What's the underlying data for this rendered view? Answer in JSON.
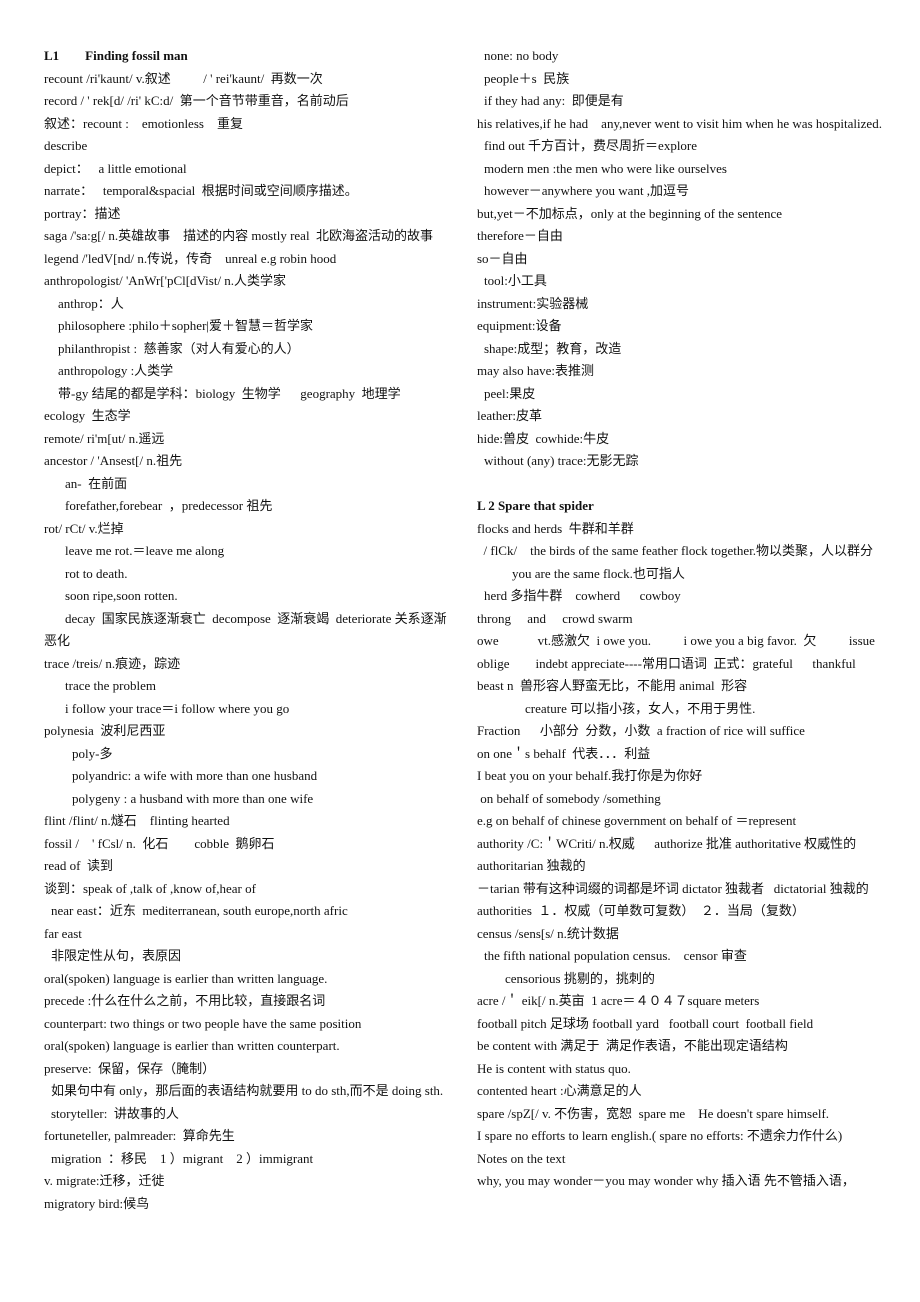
{
  "left_column": [
    {
      "text": "L1        Finding fossil man",
      "style": "bold",
      "indent": 0
    },
    {
      "text": "recount /ri'kaunt/ v.叙述          / ' rei'kaunt/  再数一次",
      "indent": 0
    },
    {
      "text": "record / ' rek[d/ /ri' kC:d/  第一个音节带重音，名前动后",
      "indent": 0
    },
    {
      "text": "叙述：recount :    emotionless    重复",
      "indent": 0
    },
    {
      "text": "describe",
      "indent": 0
    },
    {
      "text": "depict：   a little emotional",
      "indent": 0
    },
    {
      "text": "narrate：   temporal&spacial  根据时间或空间顺序描述。",
      "indent": 0
    },
    {
      "text": "portray：描述",
      "indent": 0
    },
    {
      "text": "saga /'sa:g[/ n.英雄故事    描述的内容 mostly real  北欧海盗活动的故事",
      "indent": 0
    },
    {
      "text": "legend /'ledV[nd/ n.传说，传奇    unreal e.g robin hood",
      "indent": 0
    },
    {
      "text": "anthropologist/ 'AnWr['pCl[dVist/ n.人类学家",
      "indent": 0
    },
    {
      "text": "anthrop：人",
      "indent": 2
    },
    {
      "text": "philosophere :philo＋sopher|爱＋智慧＝哲学家",
      "indent": 2
    },
    {
      "text": "philanthropist :  慈善家（对人有爱心的人）",
      "indent": 2
    },
    {
      "text": "anthropology :人类学",
      "indent": 2
    },
    {
      "text": "带-gy 结尾的都是学科：biology  生物学      geography  地理学",
      "indent": 2
    },
    {
      "text": "ecology  生态学",
      "indent": 0
    },
    {
      "text": "remote/ ri'm[ut/ n.遥远",
      "indent": 0
    },
    {
      "text": "ancestor / 'Ansest[/ n.祖先",
      "indent": 0
    },
    {
      "text": "an-  在前面",
      "indent": 3
    },
    {
      "text": "forefather,forebear  ，predecessor 祖先",
      "indent": 3
    },
    {
      "text": "rot/ rCt/ v.烂掉",
      "indent": 0
    },
    {
      "text": "leave me rot.＝leave me along",
      "indent": 3
    },
    {
      "text": "rot to death.",
      "indent": 3
    },
    {
      "text": "soon ripe,soon rotten.",
      "indent": 3
    },
    {
      "text": "decay  国家民族逐渐衰亡  decompose  逐渐衰竭  deteriorate 关系逐渐恶化",
      "indent": 3,
      "hanging": true
    },
    {
      "text": "trace /treis/ n.痕迹，踪迹",
      "indent": 0
    },
    {
      "text": "trace the problem",
      "indent": 3
    },
    {
      "text": "i follow your trace＝i follow where you go",
      "indent": 3
    },
    {
      "text": "polynesia  波利尼西亚",
      "indent": 0
    },
    {
      "text": "poly-多",
      "indent": 4
    },
    {
      "text": "polyandric: a wife with more than one husband",
      "indent": 4
    },
    {
      "text": "polygeny : a husband with more than one wife",
      "indent": 4
    },
    {
      "text": "flint /flint/ n.燧石    flinting hearted",
      "indent": 0
    },
    {
      "text": "fossil /    ' fCsl/ n.  化石        cobble  鹅卵石",
      "indent": 0
    },
    {
      "text": "read of  读到",
      "indent": 0
    },
    {
      "text": "谈到：speak of ,talk of ,know of,hear of",
      "indent": 0
    },
    {
      "text": "near east：近东  mediterranean, south europe,north afric",
      "indent": 1
    },
    {
      "text": "far east",
      "indent": 0
    },
    {
      "text": "非限定性从句，表原因",
      "indent": 1
    },
    {
      "text": "oral(spoken) language is earlier than written language.",
      "indent": 0
    },
    {
      "text": "precede :什么在什么之前，不用比较，直接跟名词",
      "indent": 0
    },
    {
      "text": "counterpart: two things or two people have the same position",
      "indent": 0
    },
    {
      "text": "oral(spoken) language is earlier than written counterpart.",
      "indent": 0
    },
    {
      "text": "preserve:  保留，保存（腌制）",
      "indent": 0
    },
    {
      "text": "如果句中有 only，那后面的表语结构就要用 to do sth,而不是 doing sth.",
      "indent": 1,
      "hanging": true
    },
    {
      "text": "storyteller:  讲故事的人",
      "indent": 1
    },
    {
      "text": "fortuneteller, palmreader:  算命先生",
      "indent": 0
    },
    {
      "text": "migration  ：移民    1 ）migrant    2 ）immigrant",
      "indent": 1
    },
    {
      "text": "v. migrate:迁移，迁徙",
      "indent": 0
    },
    {
      "text": "migratory bird:候鸟",
      "indent": 0
    }
  ],
  "right_column": [
    {
      "text": "none: no body",
      "indent": 1
    },
    {
      "text": "people＋s  民族",
      "indent": 1
    },
    {
      "text": "if they had any:  即便是有",
      "indent": 1
    },
    {
      "text": "his relatives,if he had    any,never went to visit him when he was hospitalized.",
      "indent": 0
    },
    {
      "text": "find out 千方百计，费尽周折＝explore",
      "indent": 1
    },
    {
      "text": "modern men :the men who were like ourselves",
      "indent": 1
    },
    {
      "text": "however－anywhere you want ,加逗号",
      "indent": 1
    },
    {
      "text": "but,yet－不加标点，only at the beginning of the sentence",
      "indent": 0
    },
    {
      "text": "therefore－自由",
      "indent": 0
    },
    {
      "text": "so－自由",
      "indent": 0
    },
    {
      "text": "tool:小工具",
      "indent": 1
    },
    {
      "text": "instrument:实验器械",
      "indent": 0
    },
    {
      "text": "equipment:设备",
      "indent": 0
    },
    {
      "text": "shape:成型；教育，改造",
      "indent": 1
    },
    {
      "text": "may also have:表推测",
      "indent": 0
    },
    {
      "text": "peel:果皮",
      "indent": 1
    },
    {
      "text": "leather:皮革",
      "indent": 0
    },
    {
      "text": "hide:兽皮  cowhide:牛皮",
      "indent": 0
    },
    {
      "text": "without (any) trace:无影无踪",
      "indent": 1
    },
    {
      "text": "",
      "indent": 0,
      "blank": true
    },
    {
      "text": "L 2 Spare that spider",
      "style": "bold",
      "indent": 0
    },
    {
      "text": "flocks and herds  牛群和羊群",
      "indent": 0
    },
    {
      "text": "  / flCk/    the birds of the same feather flock together.物以类聚，人以群分",
      "indent": 0
    },
    {
      "text": "you are the same flock.也可指人",
      "indent": 5
    },
    {
      "text": "herd 多指牛群    cowherd      cowboy",
      "indent": 1
    },
    {
      "text": "throng     and     crowd swarm",
      "indent": 0
    },
    {
      "text": "owe            vt.感激欠  i owe you.          i owe you a big favor.  欠          issue",
      "indent": 0
    },
    {
      "text": "oblige        indebt appreciate----常用口语词  正式：grateful      thankful",
      "indent": 0
    },
    {
      "text": "beast n  兽形容人野蛮无比，不能用 animal  形容",
      "indent": 0
    },
    {
      "text": "creature 可以指小孩，女人，不用于男性.",
      "indent": 6
    },
    {
      "text": "Fraction      小部分  分数，小数  a fraction of rice will suffice",
      "indent": 0
    },
    {
      "text": "on one＇s behalf  代表．．．利益",
      "indent": 0
    },
    {
      "text": "I beat you on your behalf.我打你是为你好",
      "indent": 0
    },
    {
      "text": " on behalf of somebody /something",
      "indent": 0
    },
    {
      "text": "e.g on behalf of chinese government on behalf of ＝represent",
      "indent": 0
    },
    {
      "text": "authority /C:＇WCriti/ n.权威      authorize 批准 authoritative 权威性的 authoritarian 独裁的",
      "indent": 0
    },
    {
      "text": "－tarian 带有这种词缀的词都是坏词 dictator 独裁者   dictatorial 独裁的",
      "indent": 0
    },
    {
      "text": "authorities  １．权威（可单数可复数）  ２．当局（复数）",
      "indent": 0
    },
    {
      "text": "census /sens[s/ n.统计数据",
      "indent": 0
    },
    {
      "text": "the fifth national population census.    censor 审查",
      "indent": 1
    },
    {
      "text": "censorious 挑剔的，挑刺的",
      "indent": 4
    },
    {
      "text": "acre /＇ eik[/ n.英亩  1 acre＝４０４７square meters",
      "indent": 0
    },
    {
      "text": "football pitch 足球场 football yard   football court  football field",
      "indent": 0
    },
    {
      "text": "be content with 满足于  满足作表语，不能出现定语结构",
      "indent": 0
    },
    {
      "text": "He is content with status quo.",
      "indent": 0
    },
    {
      "text": "contented heart :心满意足的人",
      "indent": 0
    },
    {
      "text": "spare /spZ[/ v. 不伤害，宽恕  spare me    He doesn't spare himself.",
      "indent": 0
    },
    {
      "text": "I spare no efforts to learn english.( spare no efforts: 不遗余力作什么)",
      "indent": 0
    },
    {
      "text": "Notes on the text",
      "indent": 0
    },
    {
      "text": "why, you may wonder－you may wonder why 插入语 先不管插入语，",
      "indent": 0
    }
  ]
}
